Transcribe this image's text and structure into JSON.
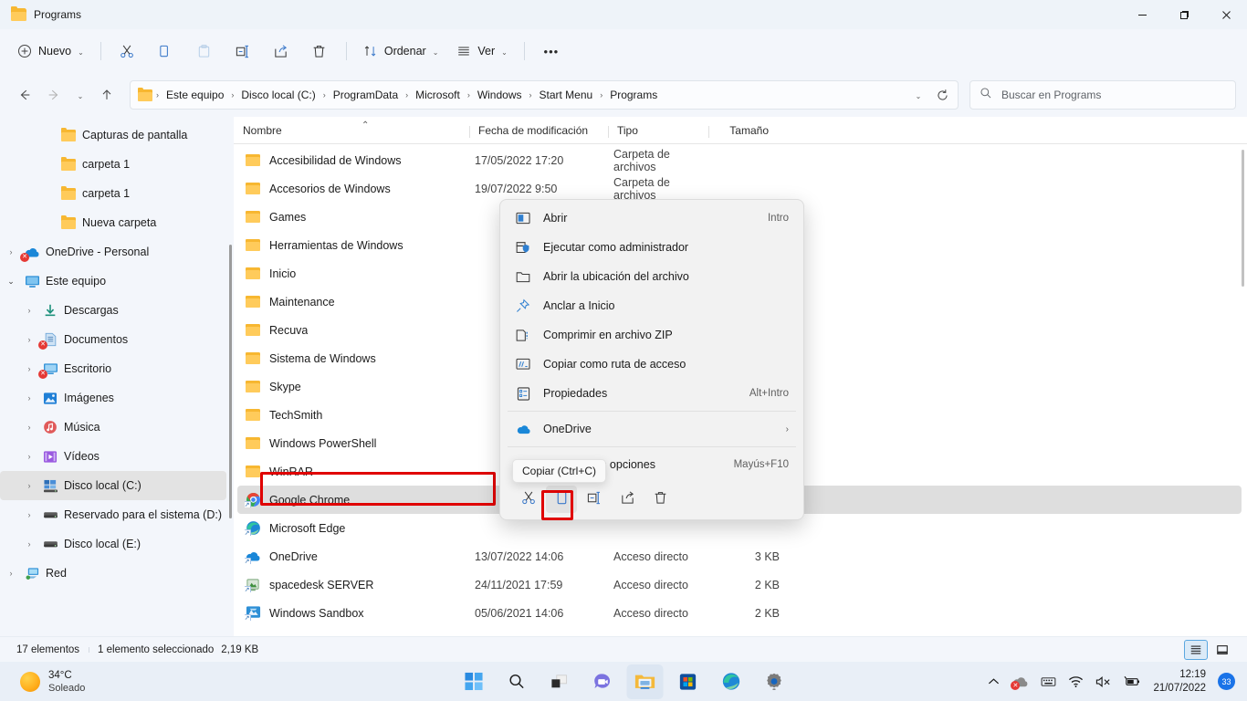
{
  "window": {
    "tab_title": "Programs",
    "minimize_label": "—",
    "maximize_label": "❐",
    "close_label": "✕"
  },
  "toolbar": {
    "new_label": "Nuevo",
    "cut_label": "Cortar",
    "copy_label": "Copiar",
    "paste_label": "Pegar",
    "rename_label": "Cambiar nombre",
    "share_label": "Compartir",
    "delete_label": "Eliminar",
    "sort_label": "Ordenar",
    "view_label": "Ver",
    "more_label": "•••"
  },
  "navigation": {
    "back_label": "←",
    "forward_label": "→",
    "recent_label": "⌄",
    "up_label": "↑",
    "breadcrumbs": [
      "Este equipo",
      "Disco local (C:)",
      "ProgramData",
      "Microsoft",
      "Windows",
      "Start Menu",
      "Programs"
    ],
    "dropdown_label": "⌄",
    "refresh_label": "⟳"
  },
  "search": {
    "placeholder": "Buscar en Programs"
  },
  "sidebar": {
    "items": [
      {
        "label": "Capturas de pantalla",
        "icon": "folder-icon",
        "indent": 2,
        "twisty": "",
        "selected": false,
        "error": false
      },
      {
        "label": "carpeta 1",
        "icon": "folder-icon",
        "indent": 2,
        "twisty": "",
        "selected": false,
        "error": false
      },
      {
        "label": "carpeta 1",
        "icon": "folder-icon",
        "indent": 2,
        "twisty": "",
        "selected": false,
        "error": false
      },
      {
        "label": "Nueva carpeta",
        "icon": "folder-icon",
        "indent": 2,
        "twisty": "",
        "selected": false,
        "error": false
      },
      {
        "label": "OneDrive - Personal",
        "icon": "onedrive-icon",
        "indent": 0,
        "twisty": "›",
        "selected": false,
        "error": true
      },
      {
        "label": "Este equipo",
        "icon": "this-pc-icon",
        "indent": 0,
        "twisty": "⌄",
        "selected": false,
        "error": false
      },
      {
        "label": "Descargas",
        "icon": "downloads-icon",
        "indent": 1,
        "twisty": "›",
        "selected": false,
        "error": false
      },
      {
        "label": "Documentos",
        "icon": "documents-icon",
        "indent": 1,
        "twisty": "›",
        "selected": false,
        "error": true
      },
      {
        "label": "Escritorio",
        "icon": "desktop-icon",
        "indent": 1,
        "twisty": "›",
        "selected": false,
        "error": true
      },
      {
        "label": "Imágenes",
        "icon": "pictures-icon",
        "indent": 1,
        "twisty": "›",
        "selected": false,
        "error": false
      },
      {
        "label": "Música",
        "icon": "music-icon",
        "indent": 1,
        "twisty": "›",
        "selected": false,
        "error": false
      },
      {
        "label": "Vídeos",
        "icon": "videos-icon",
        "indent": 1,
        "twisty": "›",
        "selected": false,
        "error": false
      },
      {
        "label": "Disco local (C:)",
        "icon": "drive-windows-icon",
        "indent": 1,
        "twisty": "›",
        "selected": true,
        "error": false
      },
      {
        "label": "Reservado para el sistema (D:)",
        "icon": "drive-icon",
        "indent": 1,
        "twisty": "›",
        "selected": false,
        "error": false
      },
      {
        "label": "Disco local (E:)",
        "icon": "drive-icon",
        "indent": 1,
        "twisty": "›",
        "selected": false,
        "error": false
      },
      {
        "label": "Red",
        "icon": "network-icon",
        "indent": 0,
        "twisty": "›",
        "selected": false,
        "error": false
      }
    ]
  },
  "filelist": {
    "columns": {
      "name": "Nombre",
      "date": "Fecha de modificación",
      "type": "Tipo",
      "size": "Tamaño"
    },
    "sort_indicator": "⌃",
    "rows": [
      {
        "name": "Accesibilidad de Windows",
        "date": "17/05/2022 17:20",
        "type": "Carpeta de archivos",
        "size": "",
        "icon": "folder-icon",
        "selected": false
      },
      {
        "name": "Accesorios de Windows",
        "date": "19/07/2022 9:50",
        "type": "Carpeta de archivos",
        "size": "",
        "icon": "folder-icon",
        "selected": false
      },
      {
        "name": "Games",
        "date": "",
        "type": "",
        "size": "",
        "icon": "folder-icon",
        "selected": false
      },
      {
        "name": "Herramientas de Windows",
        "date": "",
        "type": "",
        "size": "",
        "icon": "folder-icon",
        "selected": false
      },
      {
        "name": "Inicio",
        "date": "",
        "type": "",
        "size": "",
        "icon": "folder-icon",
        "selected": false
      },
      {
        "name": "Maintenance",
        "date": "",
        "type": "",
        "size": "",
        "icon": "folder-icon",
        "selected": false
      },
      {
        "name": "Recuva",
        "date": "",
        "type": "",
        "size": "",
        "icon": "folder-icon",
        "selected": false
      },
      {
        "name": "Sistema de Windows",
        "date": "",
        "type": "",
        "size": "",
        "icon": "folder-icon",
        "selected": false
      },
      {
        "name": "Skype",
        "date": "",
        "type": "",
        "size": "",
        "icon": "folder-icon",
        "selected": false
      },
      {
        "name": "TechSmith",
        "date": "",
        "type": "",
        "size": "",
        "icon": "folder-icon",
        "selected": false
      },
      {
        "name": "Windows PowerShell",
        "date": "",
        "type": "",
        "size": "",
        "icon": "folder-icon",
        "selected": false
      },
      {
        "name": "WinRAR",
        "date": "",
        "type": "",
        "size": "",
        "icon": "folder-icon",
        "selected": false
      },
      {
        "name": "Google Chrome",
        "date": "",
        "type": "",
        "size": "",
        "icon": "chrome-icon",
        "selected": true
      },
      {
        "name": "Microsoft Edge",
        "date": "",
        "type": "",
        "size": "",
        "icon": "edge-icon",
        "selected": false
      },
      {
        "name": "OneDrive",
        "date": "13/07/2022 14:06",
        "type": "Acceso directo",
        "size": "3 KB",
        "icon": "onedrive-icon",
        "selected": false
      },
      {
        "name": "spacedesk SERVER",
        "date": "24/11/2021 17:59",
        "type": "Acceso directo",
        "size": "2 KB",
        "icon": "spacedesk-icon",
        "selected": false
      },
      {
        "name": "Windows Sandbox",
        "date": "05/06/2021 14:06",
        "type": "Acceso directo",
        "size": "2 KB",
        "icon": "sandbox-icon",
        "selected": false
      }
    ]
  },
  "context_menu": {
    "items": [
      {
        "label": "Abrir",
        "shortcut": "Intro",
        "icon": "open-icon",
        "chevron": ""
      },
      {
        "label": "Ejecutar como administrador",
        "shortcut": "",
        "icon": "shield-icon",
        "chevron": ""
      },
      {
        "label": "Abrir la ubicación del archivo",
        "shortcut": "",
        "icon": "folder-open-icon",
        "chevron": ""
      },
      {
        "label": "Anclar a Inicio",
        "shortcut": "",
        "icon": "pin-icon",
        "chevron": ""
      },
      {
        "label": "Comprimir en archivo ZIP",
        "shortcut": "",
        "icon": "zip-icon",
        "chevron": ""
      },
      {
        "label": "Copiar como ruta de acceso",
        "shortcut": "",
        "icon": "copy-path-icon",
        "chevron": ""
      },
      {
        "label": "Propiedades",
        "shortcut": "Alt+Intro",
        "icon": "properties-icon",
        "chevron": ""
      }
    ],
    "onedrive": {
      "label": "OneDrive",
      "shortcut": "",
      "icon": "onedrive-icon",
      "chevron": "›"
    },
    "more_options": {
      "label": "Mostrar más opciones",
      "shortcut": "Mayús+F10",
      "icon": "",
      "chevron": ""
    },
    "toolbar": {
      "cut_label": "Cortar",
      "copy_label": "Copiar",
      "rename_label": "Cambiar nombre",
      "share_label": "Compartir",
      "delete_label": "Eliminar"
    },
    "tooltip": "Copiar (Ctrl+C)"
  },
  "statusbar": {
    "item_count": "17 elementos",
    "selection": "1 elemento seleccionado",
    "selection_size": "2,19 KB",
    "details_view_label": "Vista de detalles",
    "large_icons_view_label": "Vista de iconos grandes"
  },
  "taskbar": {
    "weather_temp": "34°C",
    "weather_desc": "Soleado",
    "items": [
      {
        "name": "start-button",
        "label": "Inicio"
      },
      {
        "name": "search-taskbar-button",
        "label": "Buscar"
      },
      {
        "name": "task-view-button",
        "label": "Vista de tareas"
      },
      {
        "name": "chat-button",
        "label": "Chat"
      },
      {
        "name": "file-explorer-button",
        "label": "Explorador de archivos"
      },
      {
        "name": "microsoft-store-button",
        "label": "Microsoft Store"
      },
      {
        "name": "edge-button",
        "label": "Microsoft Edge"
      },
      {
        "name": "settings-button",
        "label": "Configuración"
      }
    ],
    "tray": {
      "overflow_label": "⌃",
      "onedrive_label": "OneDrive",
      "keyboard_label": "Teclado",
      "wifi_label": "Wi-Fi",
      "volume_label": "Volumen silenciado",
      "battery_label": "Batería",
      "time": "12:19",
      "date": "21/07/2022",
      "notification_count": "33"
    }
  },
  "colors": {
    "accent": "#0078d4",
    "folder": "#ffcb5b",
    "annotation_red": "#e00000",
    "selection": "#dedede"
  }
}
